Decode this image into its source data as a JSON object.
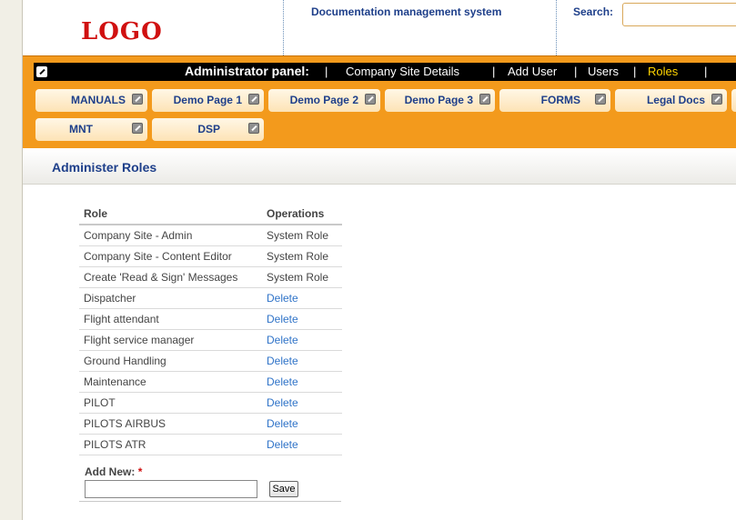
{
  "header": {
    "logo": "LOGO",
    "system_title": "Documentation management system",
    "search_label": "Search:",
    "search_value": ""
  },
  "admin_bar": {
    "title": "Administrator panel:",
    "links": [
      "Company Site Details",
      "Add User",
      "Users",
      "Roles"
    ],
    "active_link": "Roles",
    "active_color": "#ffd400"
  },
  "tabs_row1": [
    "MANUALS",
    "Demo Page 1",
    "Demo Page 2",
    "Demo Page 3",
    "FORMS",
    "Legal Docs"
  ],
  "tabs_row2": [
    "MNT",
    "DSP"
  ],
  "section": {
    "title": "Administer Roles"
  },
  "roles_table": {
    "headers": [
      "Role",
      "Operations"
    ],
    "rows": [
      {
        "role": "Company Site - Admin",
        "op": "System Role"
      },
      {
        "role": "Company Site - Content Editor",
        "op": "System Role"
      },
      {
        "role": "Create 'Read & Sign' Messages",
        "op": "System Role"
      },
      {
        "role": "Dispatcher",
        "op": "Delete"
      },
      {
        "role": "Flight attendant",
        "op": "Delete"
      },
      {
        "role": "Flight service manager",
        "op": "Delete"
      },
      {
        "role": "Ground Handling",
        "op": "Delete"
      },
      {
        "role": "Maintenance",
        "op": "Delete"
      },
      {
        "role": "PILOT",
        "op": "Delete"
      },
      {
        "role": "PILOTS AIRBUS",
        "op": "Delete"
      },
      {
        "role": "PILOTS ATR",
        "op": "Delete"
      }
    ]
  },
  "add_new": {
    "label": "Add New:",
    "required_mark": "*",
    "value": "",
    "save_label": "Save"
  },
  "colors": {
    "orange": "#f39a1c",
    "brand_blue": "#1e3f8a",
    "logo_red": "#d01010",
    "link_blue": "#2f73c8"
  }
}
